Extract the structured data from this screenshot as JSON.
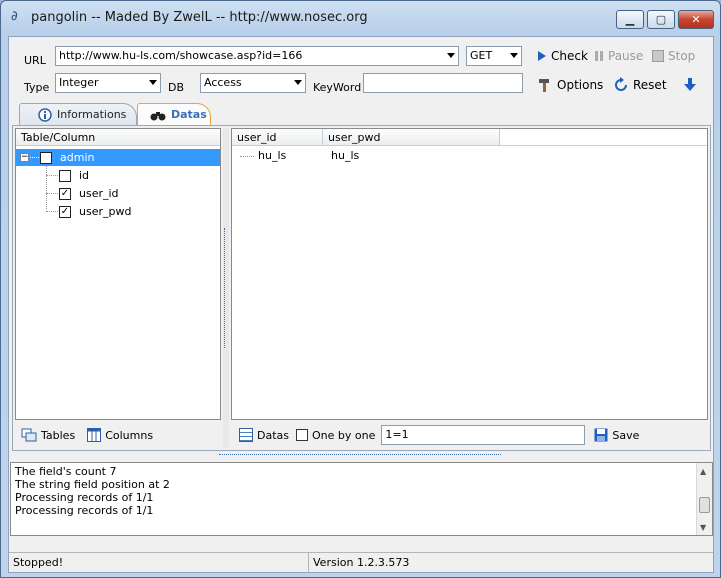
{
  "window": {
    "title": "pangolin -- Maded By ZwelL -- http://www.nosec.org",
    "min_glyph": "▁",
    "max_glyph": "▢",
    "close_glyph": "✕"
  },
  "toolbar": {
    "url_label": "URL",
    "url_value": "http://www.hu-ls.com/showcase.asp?id=166",
    "method_value": "GET",
    "check_label": "Check",
    "pause_label": "Pause",
    "stop_label": "Stop",
    "type_label": "Type",
    "type_value": "Integer",
    "db_label": "DB",
    "db_value": "Access",
    "keyword_label": "KeyWord",
    "keyword_value": "",
    "options_label": "Options",
    "reset_label": "Reset"
  },
  "tabs": [
    {
      "label": "Informations",
      "icon": "info-icon",
      "active": false
    },
    {
      "label": "Datas",
      "icon": "binoculars-icon",
      "active": true
    }
  ],
  "tree": {
    "header": "Table/Column",
    "table": {
      "name": "admin",
      "checked": false,
      "expanded": true
    },
    "columns": [
      {
        "name": "id",
        "checked": false
      },
      {
        "name": "user_id",
        "checked": true
      },
      {
        "name": "user_pwd",
        "checked": true
      }
    ],
    "tables_btn": "Tables",
    "columns_btn": "Columns"
  },
  "grid": {
    "headers": [
      "user_id",
      "user_pwd"
    ],
    "rows": [
      [
        "hu_ls",
        "hu_ls"
      ]
    ],
    "datas_btn": "Datas",
    "one_by_one_label": "One by one",
    "condition_value": "1=1",
    "save_btn": "Save"
  },
  "log": [
    "The field's count 7",
    "The string field position at 2",
    "Processing records of 1/1",
    "Processing records of 1/1"
  ],
  "status": {
    "state": "Stopped!",
    "version": "Version  1.2.3.573"
  },
  "colors": {
    "selection": "#3399ff",
    "active_tab_border": "#e8a53c",
    "active_tab_text": "#3a6fb8",
    "icon_blue": "#1f5fbf"
  }
}
